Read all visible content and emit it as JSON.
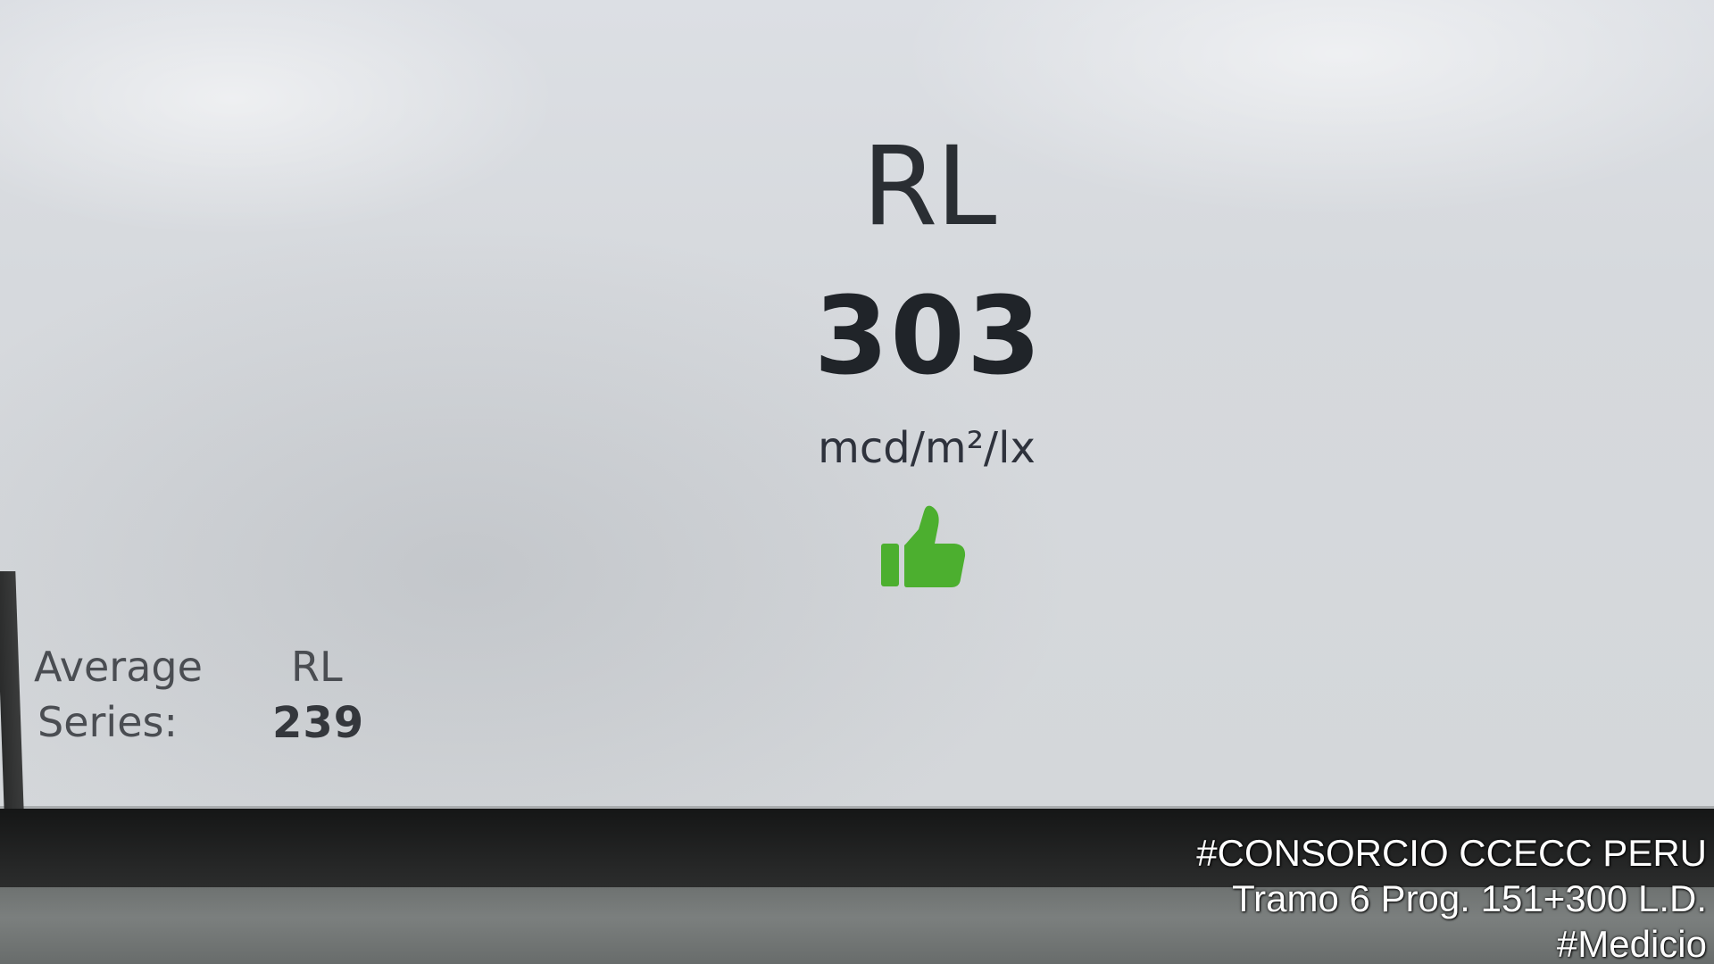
{
  "display": {
    "measurement_title": "RL",
    "measurement_value": "303",
    "unit": "mcd/m²/lx",
    "status_icon": "thumbs-up-icon",
    "status_color": "#4caf2f"
  },
  "average_series": {
    "label_line1": "Average",
    "label_line2": "Series:",
    "parameter": "RL",
    "value": "239"
  },
  "watermark": {
    "line1": "#CONSORCIO CCECC PERU",
    "line2": "Tramo 6 Prog. 151+300 L.D.",
    "line3": "#Medicio"
  }
}
